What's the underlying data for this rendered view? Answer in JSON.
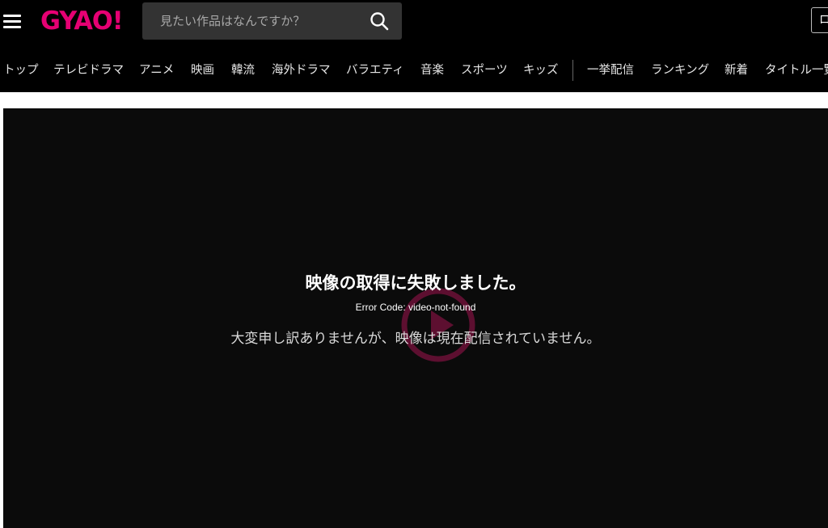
{
  "header": {
    "logo": "GYAO!",
    "logo_color": "#e60073",
    "search_placeholder": "見たい作品はなんですか？",
    "login_label": "ログイン"
  },
  "nav": {
    "items": [
      "トップ",
      "テレビドラマ",
      "アニメ",
      "映画",
      "韓流",
      "海外ドラマ",
      "バラエティ",
      "音楽",
      "スポーツ",
      "キッズ",
      "一挙配信",
      "ランキング",
      "新着",
      "タイトル一覧"
    ]
  },
  "player": {
    "error_title": "映像の取得に失敗しました。",
    "error_code": "Error Code: video-not-found",
    "error_message": "大変申し訳ありませんが、映像は現在配信されていません。",
    "play_icon_color": "#a0144f"
  },
  "icons": {
    "menu": "hamburger-menu-icon",
    "search": "search-icon",
    "play": "play-icon"
  }
}
